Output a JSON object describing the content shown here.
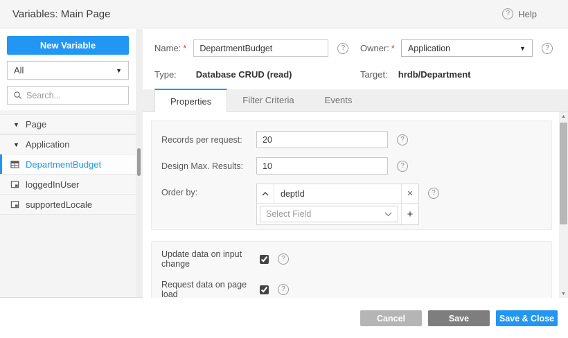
{
  "header": {
    "title": "Variables: Main Page",
    "help_label": "Help",
    "help_icon": "?"
  },
  "sidebar": {
    "new_variable_label": "New Variable",
    "filter_value": "All",
    "search_placeholder": "Search...",
    "tree": [
      {
        "label": "Page"
      },
      {
        "label": "Application"
      },
      {
        "label": "DepartmentBudget"
      },
      {
        "label": "loggedInUser"
      },
      {
        "label": "supportedLocale"
      }
    ]
  },
  "form": {
    "name_label": "Name:",
    "name_value": "DepartmentBudget",
    "owner_label": "Owner:",
    "owner_value": "Application",
    "type_label": "Type:",
    "type_value": "Database CRUD (read)",
    "target_label": "Target:",
    "target_value": "hrdb/Department",
    "required_marker": "*",
    "help_icon": "?"
  },
  "tabs": {
    "properties": "Properties",
    "filter_criteria": "Filter Criteria",
    "events": "Events"
  },
  "properties": {
    "records_per_request_label": "Records per request:",
    "records_per_request_value": "20",
    "design_max_results_label": "Design Max. Results:",
    "design_max_results_value": "10",
    "order_by_label": "Order by:",
    "order_by_field": "deptId",
    "order_by_remove": "✕",
    "order_by_add": "+",
    "select_field_placeholder": "Select Field"
  },
  "options": {
    "update_on_input_label": "Update data on input change",
    "update_on_input_checked": "checked",
    "request_on_load_label": "Request data on page load",
    "request_on_load_checked": "checked"
  },
  "footer": {
    "cancel_label": "Cancel",
    "save_label": "Save",
    "save_close_label": "Save & Close"
  },
  "colors": {
    "accent": "#2196f3",
    "cancel_button": "#b5b5b5",
    "save_button": "#7e7e7e",
    "header_bg": "#f5f5f5",
    "panel_bg": "#f8f8f8"
  }
}
